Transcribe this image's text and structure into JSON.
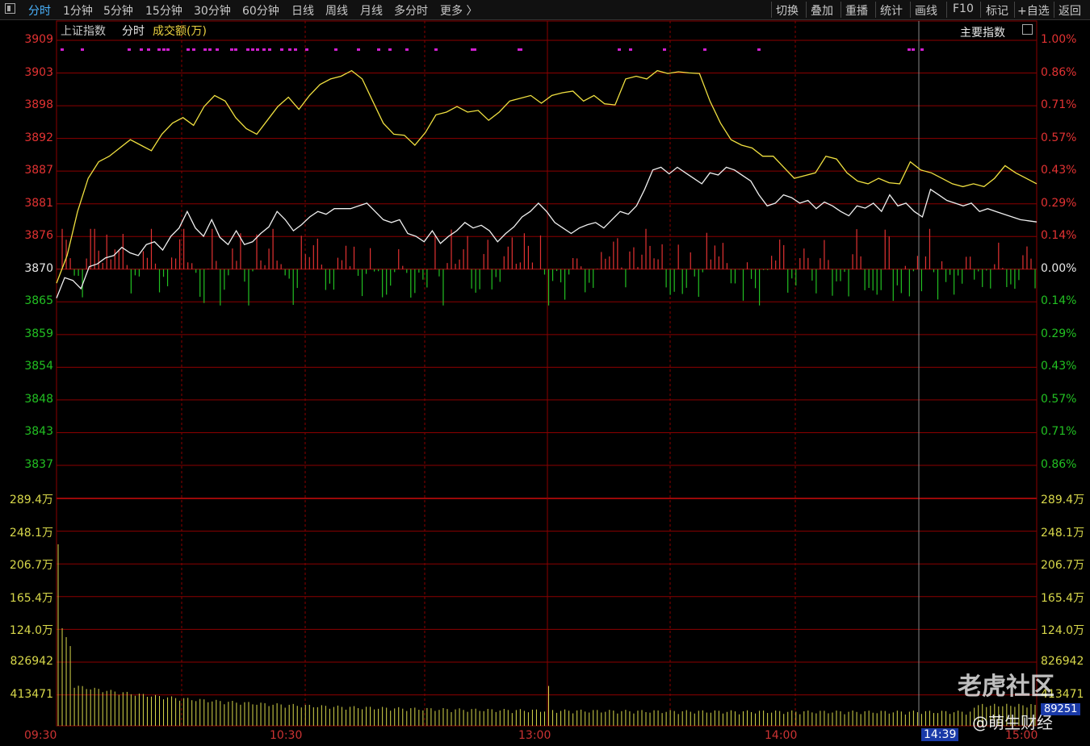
{
  "toolbar": {
    "period_tabs": [
      "分时",
      "1分钟",
      "5分钟",
      "15分钟",
      "30分钟",
      "60分钟",
      "日线",
      "周线",
      "月线",
      "多分时",
      "更多 〉"
    ],
    "actions": [
      "切换",
      "叠加",
      "重播",
      "统计",
      "画线",
      "F10",
      "标记",
      "+自选",
      "返回"
    ]
  },
  "subheader": {
    "instrument": "上证指数",
    "mode": "分时",
    "indicator": "成交额(万)",
    "right_label": "主要指数"
  },
  "watermark": {
    "brand": "老虎社区",
    "author": "@萌生财经"
  },
  "colors": {
    "up": "#e23232",
    "down": "#22c022",
    "price_line": "#f0f0f0",
    "avg_line": "#f0e040",
    "grid": "#8b0000",
    "marker": "#d020d0",
    "volume": "#d8d84a",
    "active_tab": "#4ab4ff"
  },
  "chart_data": {
    "type": "line",
    "price_axis": {
      "ticks": [
        "3909",
        "3903",
        "3898",
        "3892",
        "3887",
        "3881",
        "3876",
        "3870",
        "3865",
        "3859",
        "3854",
        "3848",
        "3843",
        "3837"
      ],
      "pct_ticks": [
        "1.00%",
        "0.86%",
        "0.71%",
        "0.57%",
        "0.43%",
        "0.29%",
        "0.14%",
        "0.00%",
        "0.14%",
        "0.29%",
        "0.43%",
        "0.57%",
        "0.71%",
        "0.86%"
      ],
      "base": 3870.2,
      "range": [
        3832,
        3909
      ]
    },
    "volume_axis": {
      "ticks": [
        "289.4万",
        "248.1万",
        "206.7万",
        "165.4万",
        "124.0万",
        "826942",
        "413471"
      ],
      "right_ticks": [
        "289.4万",
        "248.1万",
        "206.7万",
        "165.4万",
        "124.0万",
        "826942",
        "413471"
      ],
      "current": "89251",
      "range": [
        0,
        3307000
      ]
    },
    "time_labels": [
      "09:30",
      "10:30",
      "13:00",
      "14:00",
      "15:00"
    ],
    "cursor_time": "14:39",
    "series": [
      {
        "name": "",
        "role": "price",
        "values": [
          3862.3,
          3866,
          3865.5,
          3864,
          3868,
          3868.5,
          3869.6,
          3870,
          3871.5,
          3870.5,
          3870,
          3872,
          3872.5,
          3871,
          3873.5,
          3875,
          3878,
          3875,
          3873.5,
          3876.5,
          3873.3,
          3872,
          3874.5,
          3872,
          3872.5,
          3874,
          3875.2,
          3878,
          3876.5,
          3874.5,
          3875.6,
          3877,
          3878,
          3877.5,
          3878.5,
          3878.5,
          3878.5,
          3879,
          3879.5,
          3878,
          3876.5,
          3876,
          3876.5,
          3874,
          3873.5,
          3872.5,
          3874.5,
          3872.2,
          3873.5,
          3874.5,
          3876,
          3875,
          3875.5,
          3874.5,
          3872.5,
          3874,
          3875.2,
          3877,
          3878,
          3879.5,
          3878,
          3876,
          3875,
          3874,
          3875,
          3875.6,
          3876,
          3875,
          3876.5,
          3878,
          3877.5,
          3879,
          3882,
          3885.5,
          3886,
          3884.8,
          3886,
          3885,
          3884,
          3883,
          3885,
          3884.6,
          3886,
          3885.5,
          3884.5,
          3883.5,
          3881,
          3879,
          3879.5,
          3881,
          3880.5,
          3879.5,
          3880,
          3878.5,
          3879.7,
          3879,
          3878,
          3877.2,
          3879,
          3878.6,
          3879.5,
          3878,
          3881,
          3879,
          3879.5,
          3878,
          3877,
          3882,
          3881,
          3880,
          3879.5,
          3879,
          3879.5,
          3878,
          3878.5,
          3878,
          3877.5,
          3877,
          3876.5,
          3876.3,
          3876.1
        ]
      },
      {
        "name": "",
        "role": "average",
        "values": [
          3865,
          3870,
          3878,
          3884,
          3887,
          3888,
          3889.5,
          3891,
          3890,
          3889,
          3892,
          3894,
          3895,
          3893.6,
          3897,
          3899,
          3898,
          3895,
          3893,
          3892,
          3894.5,
          3897,
          3898.7,
          3896.5,
          3899,
          3901,
          3902,
          3902.5,
          3903.5,
          3902,
          3898,
          3894,
          3892,
          3891.8,
          3890,
          3892.3,
          3895.5,
          3896,
          3897,
          3896,
          3896.3,
          3894.5,
          3896,
          3898,
          3898.5,
          3899,
          3897.6,
          3899,
          3899.5,
          3899.8,
          3898,
          3899,
          3897.5,
          3897.3,
          3902,
          3902.5,
          3902,
          3903.5,
          3903,
          3903.3,
          3903.1,
          3903,
          3898,
          3894,
          3891,
          3890,
          3889.5,
          3888,
          3888,
          3886,
          3884,
          3884.5,
          3885,
          3888,
          3887.5,
          3885,
          3883.5,
          3883,
          3884,
          3883.2,
          3883,
          3887,
          3885.5,
          3885,
          3884,
          3883,
          3882.5,
          3883,
          3882.5,
          3884,
          3886.3,
          3885,
          3884,
          3883
        ]
      }
    ],
    "markers_note": "magenta dots mark signal minutes"
  }
}
